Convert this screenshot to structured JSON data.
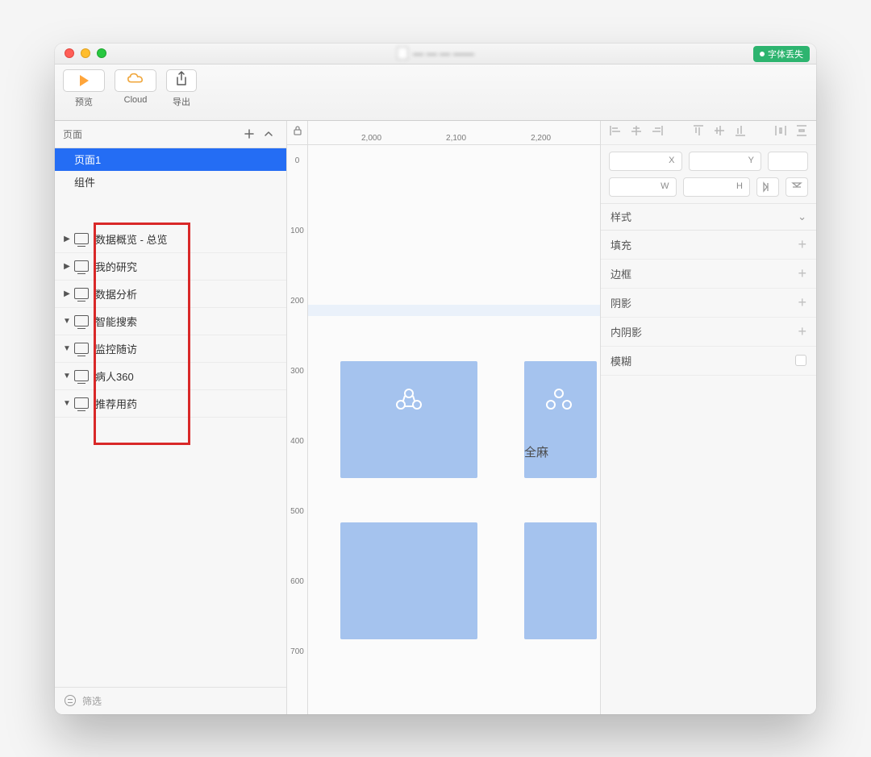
{
  "title_bar": {
    "doc_name_obscured": "— — — ——",
    "font_missing_label": "字体丢失"
  },
  "toolbar": {
    "preview_label": "预览",
    "cloud_label": "Cloud",
    "export_label": "导出"
  },
  "left_panel": {
    "header_label": "页面",
    "page1_label": "页面1",
    "components_label": "组件",
    "layers": [
      {
        "expanded": false,
        "name": "数据概览 - 总览"
      },
      {
        "expanded": false,
        "name": "我的研究"
      },
      {
        "expanded": false,
        "name": "数据分析"
      },
      {
        "expanded": true,
        "name": "智能搜索"
      },
      {
        "expanded": true,
        "name": "监控随访"
      },
      {
        "expanded": true,
        "name": "病人360"
      },
      {
        "expanded": true,
        "name": "推荐用药"
      }
    ],
    "filter_label": "筛选"
  },
  "canvas": {
    "ruler_h": [
      "2,000",
      "2,100",
      "2,200"
    ],
    "ruler_v": [
      "0",
      "100",
      "200",
      "300",
      "400",
      "500",
      "600",
      "700"
    ],
    "card2_label": "全麻"
  },
  "inspector": {
    "coords": {
      "x": "X",
      "y": "Y",
      "w": "W",
      "h": "H"
    },
    "style_label": "样式",
    "fill_label": "填充",
    "border_label": "边框",
    "shadow_label": "阴影",
    "inner_shadow_label": "内阴影",
    "blur_label": "模糊"
  }
}
